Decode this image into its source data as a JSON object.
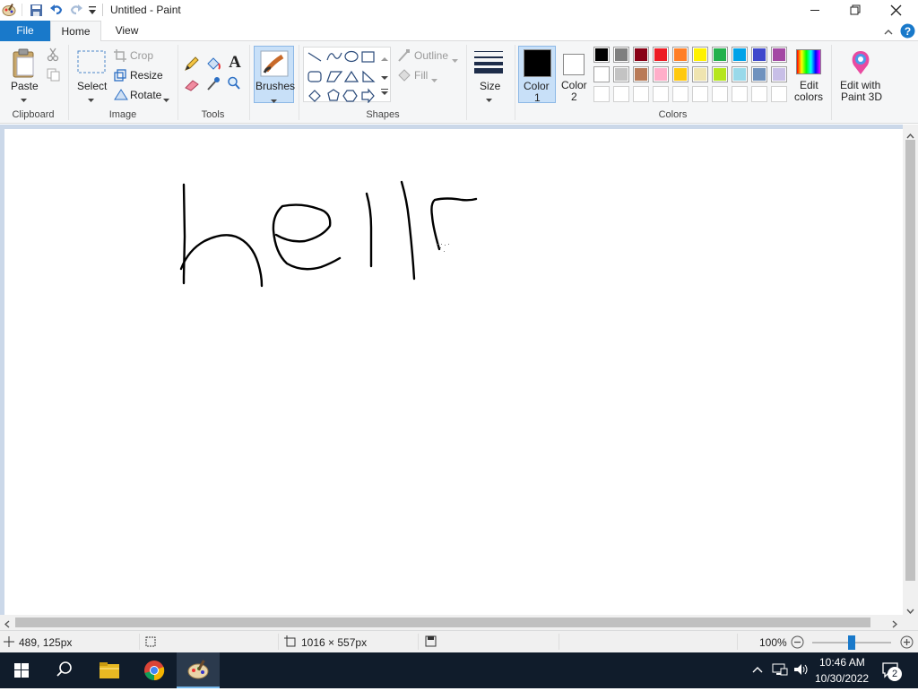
{
  "window": {
    "title": "Untitled - Paint"
  },
  "tabs": {
    "file": "File",
    "home": "Home",
    "view": "View"
  },
  "clipboard": {
    "paste": "Paste",
    "group": "Clipboard"
  },
  "image": {
    "select": "Select",
    "crop": "Crop",
    "resize": "Resize",
    "rotate": "Rotate",
    "group": "Image"
  },
  "tools": {
    "group": "Tools"
  },
  "brushes": {
    "label": "Brushes"
  },
  "shapes": {
    "outline": "Outline",
    "fill": "Fill",
    "group": "Shapes"
  },
  "size": {
    "label": "Size"
  },
  "colors": {
    "color1_line1": "Color",
    "color1_line2": "1",
    "color2_line1": "Color",
    "color2_line2": "2",
    "edit_line1": "Edit",
    "edit_line2": "colors",
    "paint3d_line1": "Edit with",
    "paint3d_line2": "Paint 3D",
    "group": "Colors",
    "palette_row1": [
      "#000000",
      "#7f7f7f",
      "#880015",
      "#ed1c24",
      "#ff7f27",
      "#fff200",
      "#22b14c",
      "#00a2e8",
      "#3f48cc",
      "#a349a4"
    ],
    "palette_row2": [
      "#ffffff",
      "#c3c3c3",
      "#b97a57",
      "#ffaec9",
      "#ffc90e",
      "#efe4b0",
      "#b5e61d",
      "#99d9ea",
      "#7092be",
      "#c8bfe7"
    ]
  },
  "status": {
    "cursor_pos": "489, 125px",
    "canvas_size": "1016 × 557px",
    "zoom": "100%"
  },
  "tray": {
    "time": "10:46 AM",
    "date": "10/30/2022",
    "notifications": "2"
  }
}
